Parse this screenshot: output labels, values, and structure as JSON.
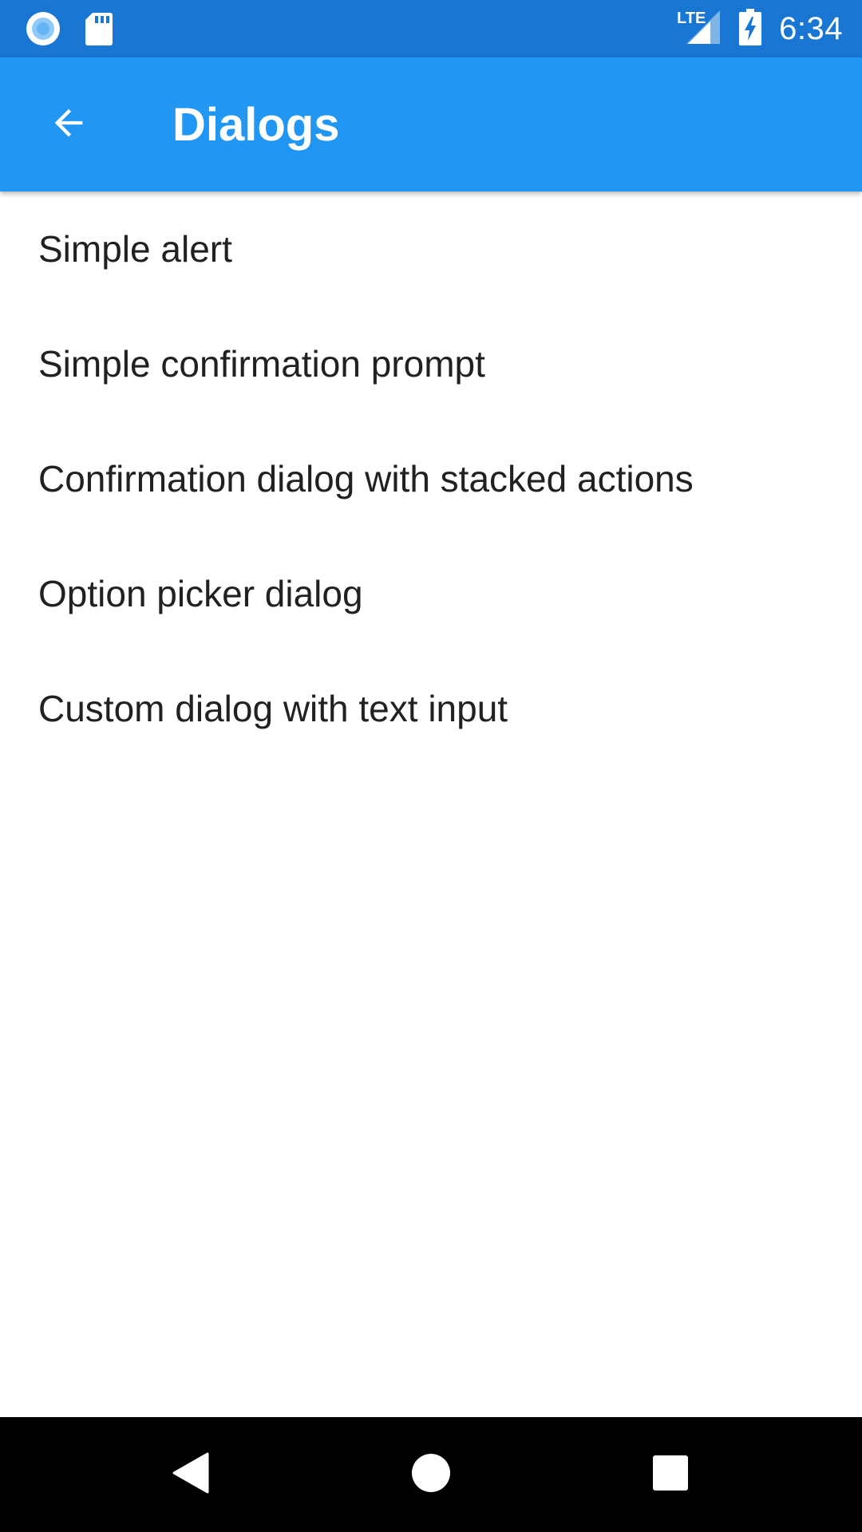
{
  "status_bar": {
    "time": "6:34",
    "network_label": "LTE",
    "icons": [
      "circle-notification-icon",
      "sd-card-icon",
      "lte-signal-icon",
      "battery-charging-icon"
    ]
  },
  "app_bar": {
    "title": "Dialogs",
    "back_icon": "arrow-back-icon"
  },
  "list": {
    "items": [
      {
        "label": "Simple alert"
      },
      {
        "label": "Simple confirmation prompt"
      },
      {
        "label": "Confirmation dialog with stacked actions"
      },
      {
        "label": "Option picker dialog"
      },
      {
        "label": "Custom dialog with text input"
      }
    ]
  },
  "nav_bar": {
    "buttons": [
      "back-triangle-icon",
      "home-circle-icon",
      "recents-square-icon"
    ]
  },
  "colors": {
    "status_bar": "#1976D2",
    "app_bar": "#2196F3",
    "text_primary": "#212121",
    "nav_bar": "#000000"
  }
}
